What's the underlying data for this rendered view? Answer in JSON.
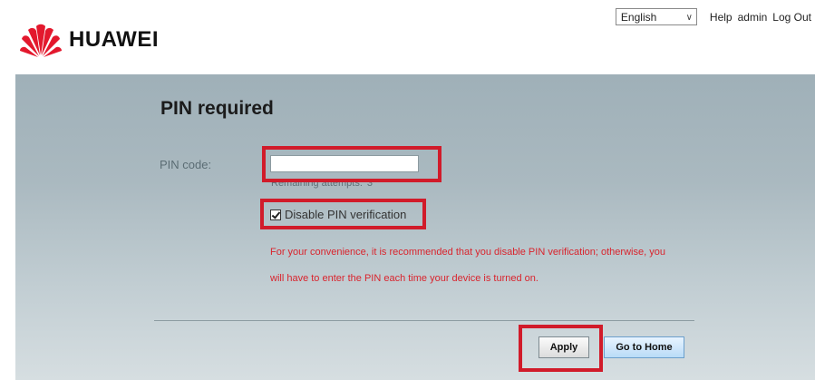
{
  "header": {
    "brand": "HUAWEI",
    "language": "English",
    "help_label": "Help",
    "user_label": "admin",
    "logout_label": "Log Out"
  },
  "main": {
    "title": "PIN required",
    "pin_label": "PIN code:",
    "pin_value": "",
    "remaining_label": "Remaining attempts:",
    "remaining_count": "3",
    "disable_checkbox_label": "Disable PIN verification",
    "disable_checked": true,
    "warning_line1": "For your convenience, it is recommended that you disable PIN verification; otherwise, you",
    "warning_line2": "will have to enter the PIN each time your device is turned on.",
    "apply_label": "Apply",
    "home_label": "Go to Home"
  },
  "colors": {
    "brand_red": "#e3182d",
    "warning_text": "#d9242d",
    "annotation_red": "#d11b2a",
    "panel_top": "#9fb0b8",
    "panel_bottom": "#d6dee1"
  },
  "icons": {
    "logo": "huawei-petals-logo",
    "language_dropdown": "chevron-down-icon",
    "checkbox": "checkmark-icon"
  }
}
